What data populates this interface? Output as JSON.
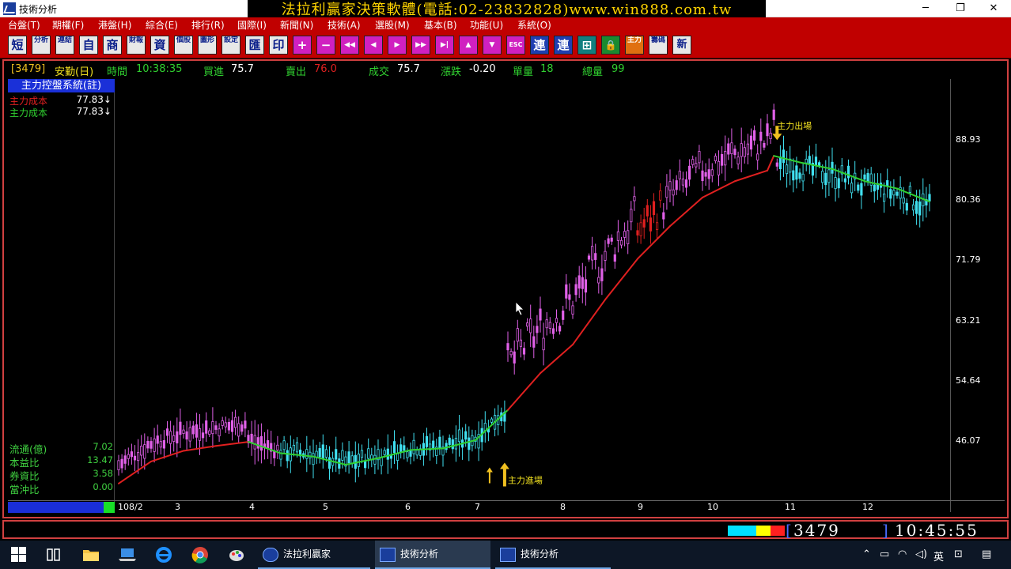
{
  "window": {
    "title": "技術分析",
    "banner": "法拉利贏家決策軟體(電話:02-23832828)www.win888.com.tw",
    "controls": [
      "─",
      "❐",
      "✕"
    ]
  },
  "menu": [
    "台盤(T)",
    "期權(F)",
    "港盤(H)",
    "綜合(E)",
    "排行(R)",
    "國際(I)",
    "新聞(N)",
    "技術(A)",
    "選股(M)",
    "基本(B)",
    "功能(U)",
    "系統(O)"
  ],
  "toolbar": [
    "短",
    "分析",
    "連結",
    "自",
    "商",
    "財報",
    "資",
    "個股",
    "圖形",
    "設定",
    "匯",
    "印",
    "+",
    "−",
    "◀◀",
    "◀",
    "▶",
    "▶▶",
    "▶|",
    "▲",
    "▼",
    "ESC",
    "連",
    "連",
    "⊞",
    "🔒",
    "主力",
    "籌碼",
    "新"
  ],
  "quote": {
    "code": "[3479]",
    "name": "安勤(日)",
    "time_label": "時間",
    "time": "10:38:35",
    "bid_label": "買進",
    "bid": "75.7",
    "ask_label": "賣出",
    "ask": "76.0",
    "deal_label": "成交",
    "deal": "75.7",
    "change_label": "漲跌",
    "change": "-0.20",
    "vol_label": "單量",
    "vol": "18",
    "total_label": "總量",
    "total": "99"
  },
  "panel": {
    "title": "主力控盤系統(註)",
    "cost_rows": [
      {
        "label": "主力成本",
        "value": "77.83↓",
        "color": "#e02020"
      },
      {
        "label": "主力成本",
        "value": "77.83↓",
        "color": "#30d030"
      }
    ],
    "ratios": [
      {
        "label": "流通(億)",
        "value": "7.02"
      },
      {
        "label": "本益比",
        "value": "13.47"
      },
      {
        "label": "券資比",
        "value": "3.58"
      },
      {
        "label": "當沖比",
        "value": "0.00"
      }
    ]
  },
  "chart_data": {
    "type": "line",
    "title": "",
    "y_ticks": [
      "88.93",
      "80.36",
      "71.79",
      "63.21",
      "54.64",
      "46.07"
    ],
    "ylim": [
      40,
      93
    ],
    "x_labels": [
      "108/2",
      "3",
      "4",
      "5",
      "6",
      "7",
      "8",
      "9",
      "10",
      "11",
      "12"
    ],
    "series": [
      {
        "name": "主力成本",
        "color_up": "#e02020",
        "color_down": "#30d030",
        "x": [
          0,
          10,
          20,
          30,
          40,
          50,
          60,
          70,
          80,
          90,
          100,
          110,
          120,
          130,
          140,
          150,
          160,
          170,
          180,
          190,
          200,
          202,
          210,
          220,
          230,
          240,
          250
        ],
        "values": [
          43.5,
          46.2,
          47.5,
          48.1,
          48.6,
          47.2,
          46.8,
          45.8,
          46.6,
          47.6,
          47.8,
          48.8,
          52.5,
          57.0,
          60.5,
          66.0,
          71.0,
          75.0,
          78.5,
          80.5,
          81.8,
          83.6,
          82.8,
          82.0,
          80.5,
          79.6,
          78.0
        ]
      }
    ],
    "annotations": [
      {
        "text": "主力進場",
        "x": 119,
        "y": 44.5
      },
      {
        "text": "主力出場",
        "x": 203,
        "y": 86.5
      }
    ]
  },
  "statusbar": {
    "code": "3479",
    "time": "10:45:55",
    "colors": [
      "#00e0ff",
      "#00e0ff",
      "#ffff00",
      "#ff2020"
    ]
  },
  "taskbar": {
    "tasks": [
      {
        "label": "法拉利贏家",
        "active": false
      },
      {
        "label": "技術分析",
        "active": true
      },
      {
        "label": "技術分析",
        "active": false
      }
    ],
    "ime": "英"
  }
}
